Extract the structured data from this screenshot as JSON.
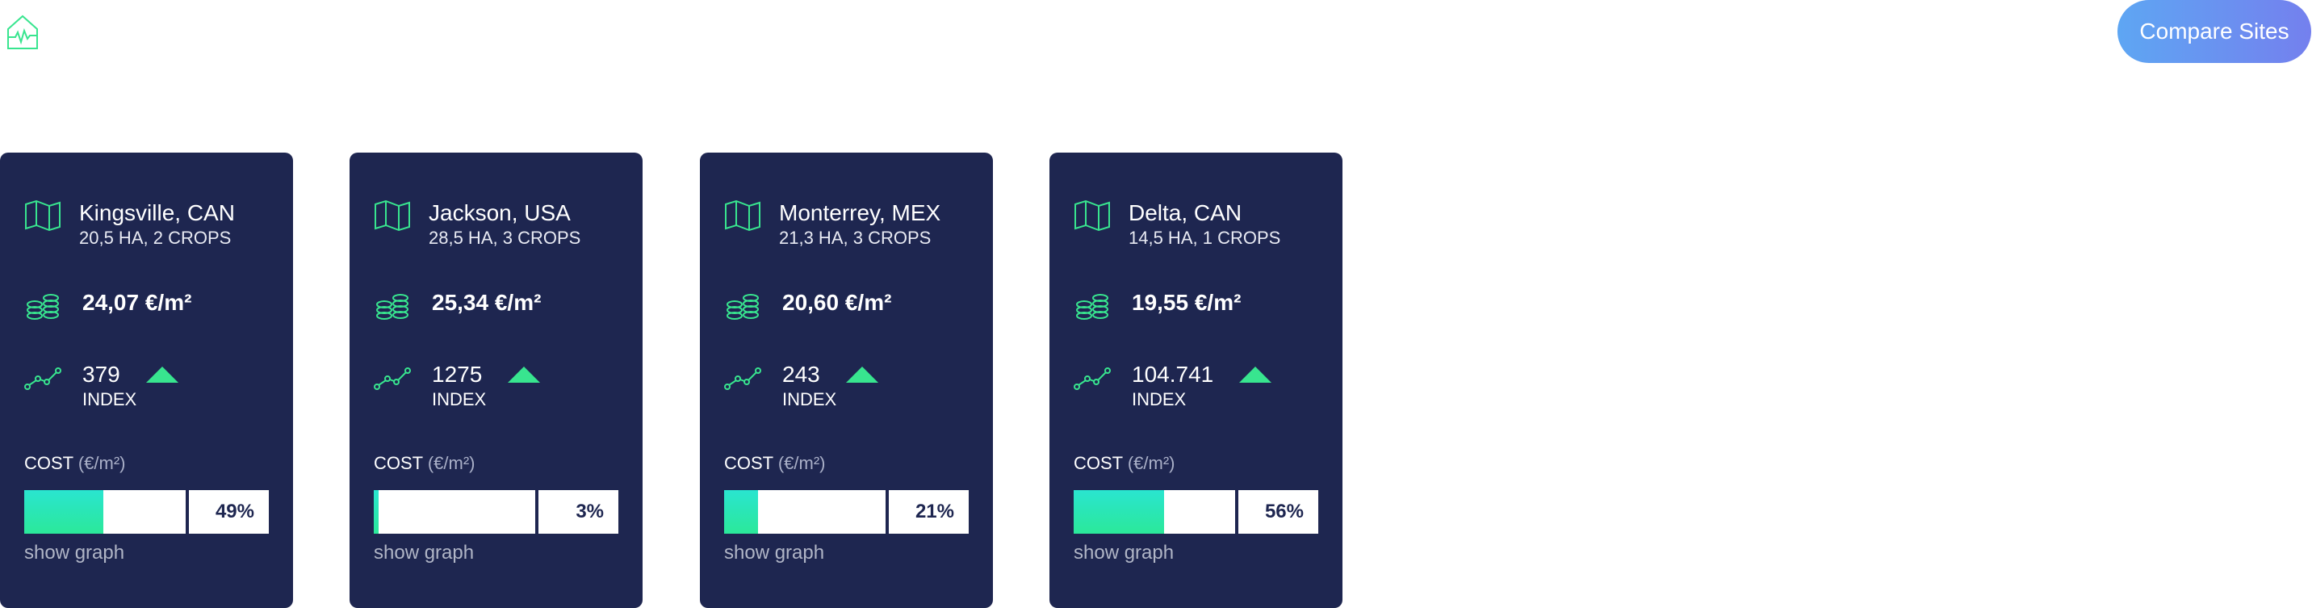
{
  "header": {
    "logo_icon": "home-pulse-icon",
    "compare_label": "Compare Sites"
  },
  "colors": {
    "card_bg": "#1e2650",
    "accent_green": "#38e58f",
    "button_gradient_start": "#5ea6f3",
    "button_gradient_end": "#7480ee"
  },
  "sites": [
    {
      "name": "Kingsville, CAN",
      "details": "20,5 HA, 2 CROPS",
      "price": "24,07 €/m²",
      "index_value": "379",
      "index_label": "INDEX",
      "trend": "up",
      "cost_label": "COST",
      "cost_unit": "(€/m²)",
      "cost_percent": "49%",
      "cost_fraction": 0.49,
      "show_graph": "show graph"
    },
    {
      "name": "Jackson, USA",
      "details": "28,5 HA, 3 CROPS",
      "price": "25,34 €/m²",
      "index_value": "1275",
      "index_label": "INDEX",
      "trend": "up",
      "cost_label": "COST",
      "cost_unit": "(€/m²)",
      "cost_percent": "3%",
      "cost_fraction": 0.03,
      "show_graph": "show graph"
    },
    {
      "name": "Monterrey, MEX",
      "details": "21,3 HA, 3 CROPS",
      "price": "20,60 €/m²",
      "index_value": "243",
      "index_label": "INDEX",
      "trend": "up",
      "cost_label": "COST",
      "cost_unit": "(€/m²)",
      "cost_percent": "21%",
      "cost_fraction": 0.21,
      "show_graph": "show graph"
    },
    {
      "name": "Delta, CAN",
      "details": "14,5 HA, 1 CROPS",
      "price": "19,55 €/m²",
      "index_value": "104.741",
      "index_label": "INDEX",
      "trend": "up",
      "cost_label": "COST",
      "cost_unit": "(€/m²)",
      "cost_percent": "56%",
      "cost_fraction": 0.56,
      "show_graph": "show graph"
    }
  ]
}
